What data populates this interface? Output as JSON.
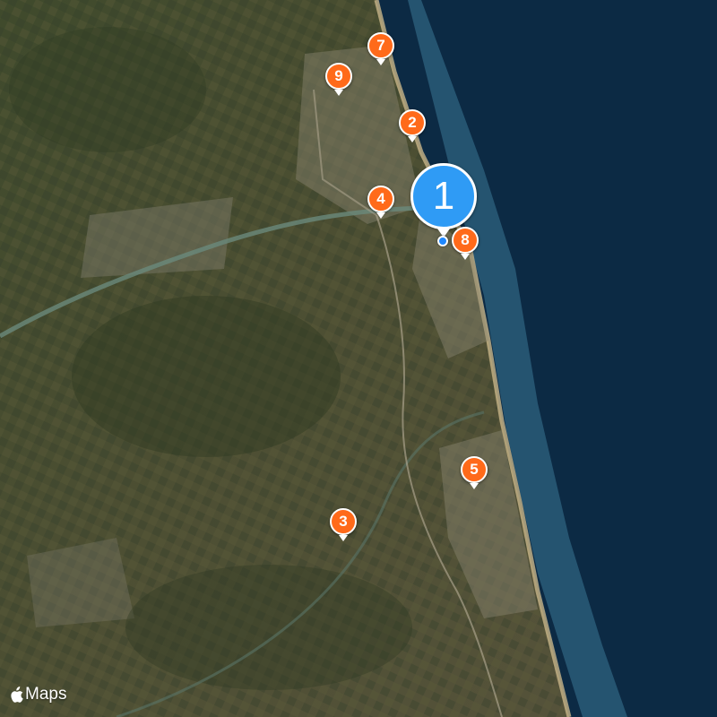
{
  "attribution": {
    "logo_icon": "apple-logo-icon",
    "label": "Maps"
  },
  "colors": {
    "pin": "#ff6a1a",
    "selected_pin": "#2f9bf5",
    "sea": "#0c2a44",
    "location_dot": "#1e88ff"
  },
  "markers": [
    {
      "label": "1",
      "selected": true
    },
    {
      "label": "2"
    },
    {
      "label": "3"
    },
    {
      "label": "4"
    },
    {
      "label": "5"
    },
    {
      "label": "7"
    },
    {
      "label": "8"
    },
    {
      "label": "9"
    }
  ],
  "current_location": {
    "icon": "current-location-dot-icon"
  }
}
